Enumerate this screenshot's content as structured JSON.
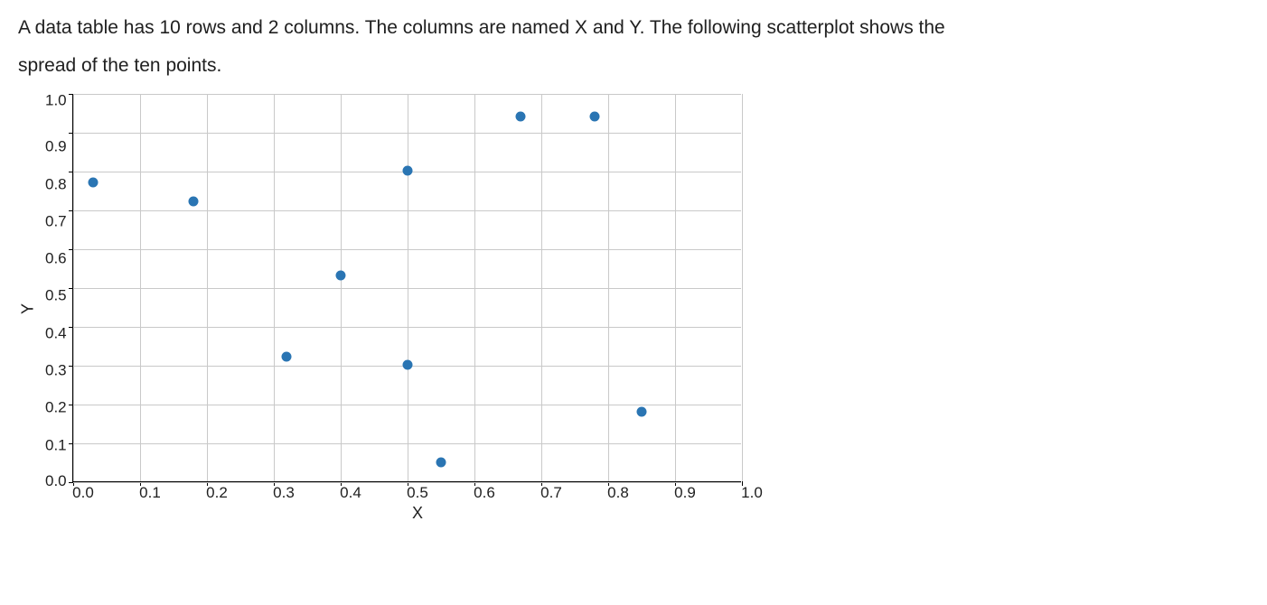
{
  "description": {
    "line1": "A data table has 10 rows and 2 columns.  The columns are named X and Y.  The following scatterplot shows the",
    "line2": "spread of the ten points."
  },
  "chart_data": {
    "type": "scatter",
    "xlabel": "X",
    "ylabel": "Y",
    "xlim": [
      0.0,
      1.0
    ],
    "ylim": [
      0.0,
      1.0
    ],
    "x_ticks": [
      "0.0",
      "0.1",
      "0.2",
      "0.3",
      "0.4",
      "0.5",
      "0.6",
      "0.7",
      "0.8",
      "0.9",
      "1.0"
    ],
    "y_ticks": [
      "1.0",
      "0.9",
      "0.8",
      "0.7",
      "0.6",
      "0.5",
      "0.4",
      "0.3",
      "0.2",
      "0.1",
      "0.0"
    ],
    "grid": true,
    "points": [
      {
        "x": 0.03,
        "y": 0.77
      },
      {
        "x": 0.18,
        "y": 0.72
      },
      {
        "x": 0.32,
        "y": 0.32
      },
      {
        "x": 0.4,
        "y": 0.53
      },
      {
        "x": 0.5,
        "y": 0.8
      },
      {
        "x": 0.5,
        "y": 0.3
      },
      {
        "x": 0.55,
        "y": 0.05
      },
      {
        "x": 0.67,
        "y": 0.94
      },
      {
        "x": 0.78,
        "y": 0.94
      },
      {
        "x": 0.85,
        "y": 0.18
      }
    ]
  }
}
